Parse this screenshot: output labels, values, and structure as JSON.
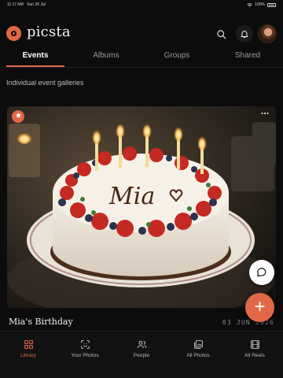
{
  "status_bar": {
    "time": "11:17 AM",
    "date": "Sun 26 Jul",
    "battery": "100%"
  },
  "header": {
    "app_title": "picsta"
  },
  "tabs": [
    {
      "label": "Events",
      "active": true
    },
    {
      "label": "Albums",
      "active": false
    },
    {
      "label": "Groups",
      "active": false
    },
    {
      "label": "Shared",
      "active": false
    }
  ],
  "section": {
    "subtitle": "Individual event galleries"
  },
  "event_card": {
    "cake_text": "Mia",
    "title": "Mia's Birthday",
    "date": "03 JUN 2026",
    "favorite_icon": "star-icon",
    "more_icon": "more-dots-icon"
  },
  "fab": {
    "add_symbol": "+",
    "chat_icon": "chat-bubble-icon"
  },
  "bottom_nav": [
    {
      "label": "Library",
      "icon": "grid-icon",
      "active": true
    },
    {
      "label": "Your Photos",
      "icon": "face-scan-icon",
      "active": false
    },
    {
      "label": "People",
      "icon": "people-icon",
      "active": false
    },
    {
      "label": "All Photos",
      "icon": "photos-icon",
      "active": false
    },
    {
      "label": "All Reels",
      "icon": "film-icon",
      "active": false
    }
  ],
  "colors": {
    "accent": "#e06847",
    "background": "#0c0c0c"
  }
}
